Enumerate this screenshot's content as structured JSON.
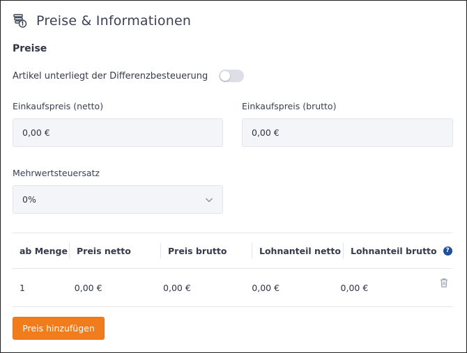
{
  "header": {
    "title": "Preise & Informationen",
    "icon": "price-tag-stack-icon"
  },
  "section": {
    "title": "Preise"
  },
  "differential_tax": {
    "label": "Artikel unterliegt der Differenzbesteuerung",
    "enabled": false
  },
  "purchase_price_net": {
    "label": "Einkaufspreis (netto)",
    "value": "0,00 €"
  },
  "purchase_price_gross": {
    "label": "Einkaufspreis (brutto)",
    "value": "0,00 €"
  },
  "vat_rate": {
    "label": "Mehrwertsteuersatz",
    "selected": "0%"
  },
  "price_table": {
    "headers": [
      "ab Menge",
      "Preis netto",
      "Preis brutto",
      "Lohnanteil netto",
      "Lohnanteil brutto"
    ],
    "rows": [
      {
        "quantity": "1",
        "price_net": "0,00 €",
        "price_gross": "0,00 €",
        "labor_net": "0,00 €",
        "labor_gross": "0,00 €"
      }
    ]
  },
  "add_price_button": {
    "label": "Preis hinzufügen"
  },
  "colors": {
    "accent": "#f07c1c",
    "help_icon": "#1f4f9c",
    "input_bg": "#f4f5f8"
  }
}
